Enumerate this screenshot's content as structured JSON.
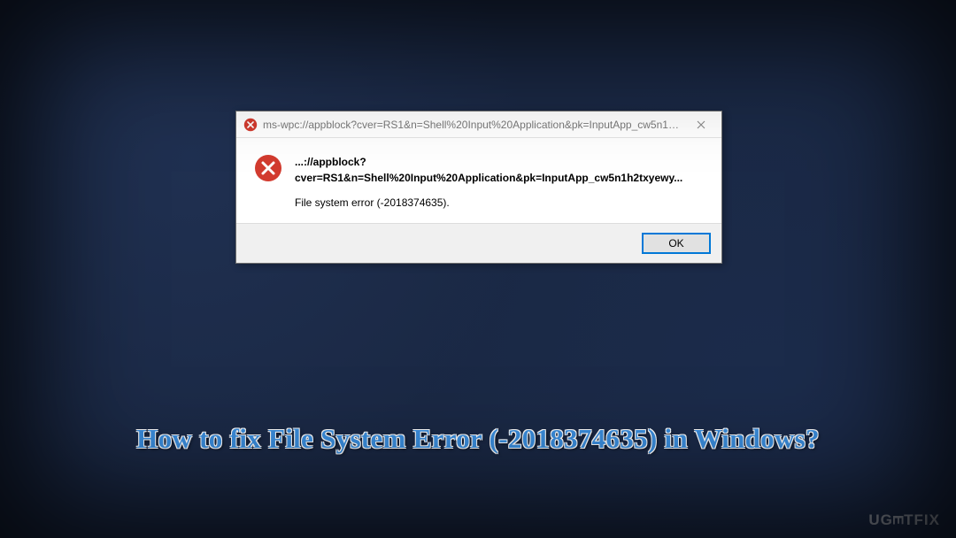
{
  "dialog": {
    "title": "ms-wpc://appblock?cver=RS1&n=Shell%20Input%20Application&pk=InputApp_cw5n1h2tx...",
    "heading": "...://appblock?cver=RS1&n=Shell%20Input%20Application&pk=InputApp_cw5n1h2txyewy...",
    "message": "File system error (-2018374635).",
    "ok_label": "OK"
  },
  "caption": "How to fix File System Error (-2018374635) in Windows?",
  "watermark": {
    "prefix": "UG",
    "rotated": "E",
    "suffix": "TFIX"
  },
  "colors": {
    "accent": "#3b8fe0",
    "error_red": "#d23b2f",
    "button_focus": "#0078d7"
  }
}
